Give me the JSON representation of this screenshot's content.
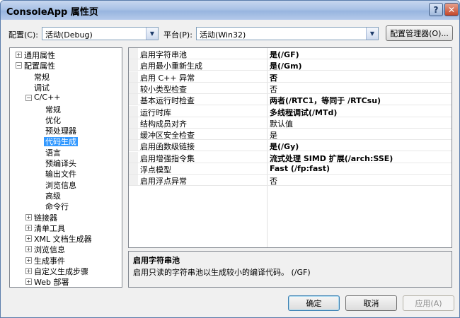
{
  "window": {
    "title": "ConsoleApp 属性页",
    "help_glyph": "?",
    "close_glyph": "✕"
  },
  "config": {
    "label": "配置(C):",
    "value": "活动(Debug)"
  },
  "platform": {
    "label": "平台(P):",
    "value": "活动(Win32)"
  },
  "config_manager_label": "配置管理器(O)...",
  "tree": [
    {
      "label": "通用属性",
      "expander": "+",
      "level": 0
    },
    {
      "label": "配置属性",
      "expander": "−",
      "level": 0
    },
    {
      "label": "常规",
      "expander": "",
      "level": 1
    },
    {
      "label": "调试",
      "expander": "",
      "level": 1
    },
    {
      "label": "C/C++",
      "expander": "−",
      "level": 1
    },
    {
      "label": "常规",
      "expander": "",
      "level": 2
    },
    {
      "label": "优化",
      "expander": "",
      "level": 2
    },
    {
      "label": "预处理器",
      "expander": "",
      "level": 2
    },
    {
      "label": "代码生成",
      "expander": "",
      "level": 2,
      "selected": true
    },
    {
      "label": "语言",
      "expander": "",
      "level": 2
    },
    {
      "label": "预编译头",
      "expander": "",
      "level": 2
    },
    {
      "label": "输出文件",
      "expander": "",
      "level": 2
    },
    {
      "label": "浏览信息",
      "expander": "",
      "level": 2
    },
    {
      "label": "高级",
      "expander": "",
      "level": 2
    },
    {
      "label": "命令行",
      "expander": "",
      "level": 2
    },
    {
      "label": "链接器",
      "expander": "+",
      "level": 1
    },
    {
      "label": "清单工具",
      "expander": "+",
      "level": 1
    },
    {
      "label": "XML 文档生成器",
      "expander": "+",
      "level": 1
    },
    {
      "label": "浏览信息",
      "expander": "+",
      "level": 1
    },
    {
      "label": "生成事件",
      "expander": "+",
      "level": 1
    },
    {
      "label": "自定义生成步骤",
      "expander": "+",
      "level": 1
    },
    {
      "label": "Web 部署",
      "expander": "+",
      "level": 1
    }
  ],
  "properties": [
    {
      "name": "启用字符串池",
      "value": "是(/GF)",
      "bold": true
    },
    {
      "name": "启用最小重新生成",
      "value": "是(/Gm)",
      "bold": true
    },
    {
      "name": "启用 C++ 异常",
      "value": "否",
      "bold": true
    },
    {
      "name": "较小类型检查",
      "value": "否",
      "bold": false
    },
    {
      "name": "基本运行时检查",
      "value": "两者(/RTC1，等同于 /RTCsu)",
      "bold": true
    },
    {
      "name": "运行时库",
      "value": "多线程调试(/MTd)",
      "bold": true
    },
    {
      "name": "结构成员对齐",
      "value": "默认值",
      "bold": false
    },
    {
      "name": "缓冲区安全检查",
      "value": "是",
      "bold": false
    },
    {
      "name": "启用函数级链接",
      "value": "是(/Gy)",
      "bold": true
    },
    {
      "name": "启用增强指令集",
      "value": "流式处理 SIMD 扩展(/arch:SSE)",
      "bold": true
    },
    {
      "name": "浮点模型",
      "value": "Fast (/fp:fast)",
      "bold": true
    },
    {
      "name": "启用浮点异常",
      "value": "否",
      "bold": false
    }
  ],
  "description": {
    "title": "启用字符串池",
    "body": "启用只读的字符串池以生成较小的编译代码。     (/GF)"
  },
  "buttons": {
    "ok": "确定",
    "cancel": "取消",
    "apply": "应用(A)"
  }
}
